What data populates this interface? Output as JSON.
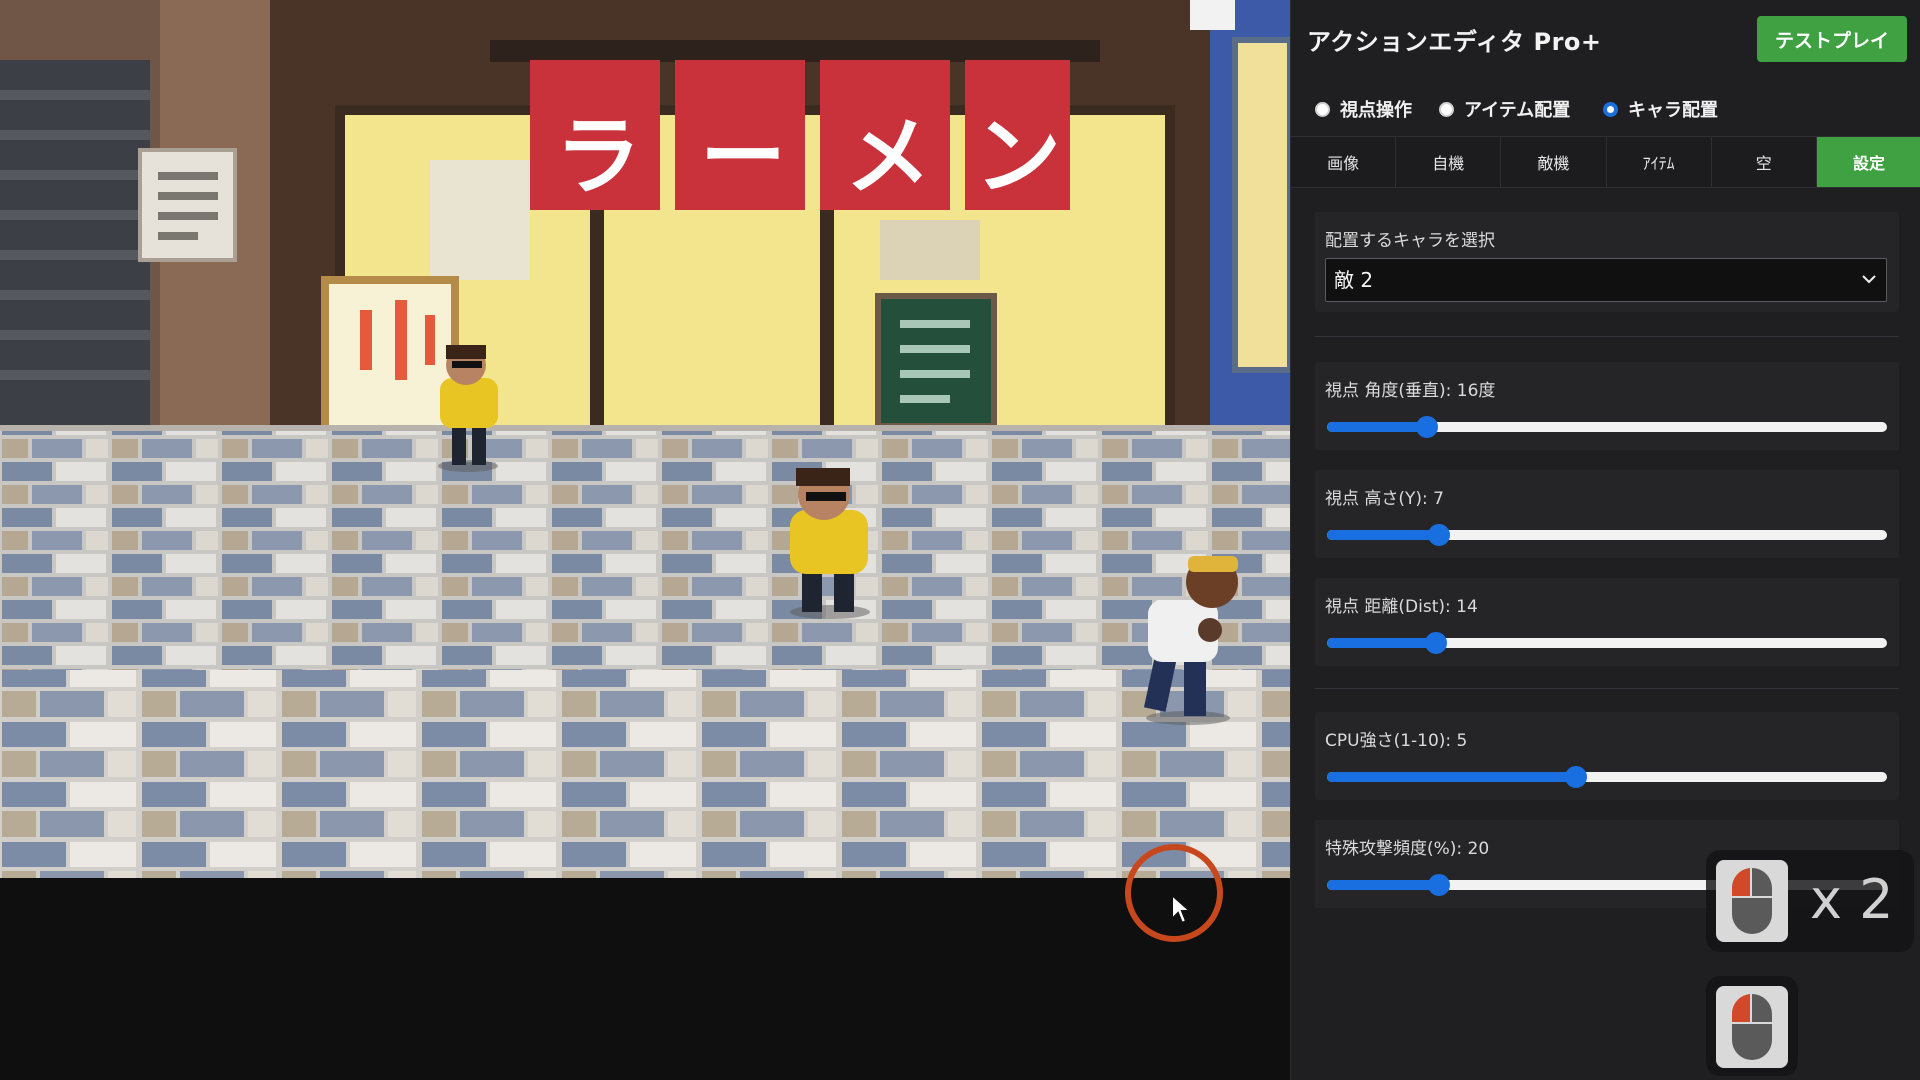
{
  "panel": {
    "title": "アクションエディタ Pro+",
    "testplay_label": "テストプレイ",
    "modes": [
      {
        "label": "視点操作",
        "checked": false
      },
      {
        "label": "アイテム配置",
        "checked": false
      },
      {
        "label": "キャラ配置",
        "checked": true
      }
    ],
    "tabs": [
      {
        "label": "画像",
        "active": false
      },
      {
        "label": "自機",
        "active": false
      },
      {
        "label": "敵機",
        "active": false
      },
      {
        "label": "ｱｲﾃﾑ",
        "active": false
      },
      {
        "label": "空",
        "active": false
      },
      {
        "label": "設定",
        "active": true
      }
    ],
    "chara_select": {
      "label": "配置するキャラを選択",
      "selected": "敵 2"
    },
    "camera_sliders": [
      {
        "label": "視点 角度(垂直): 16度",
        "value": 16,
        "min": 0,
        "max": 90
      },
      {
        "label": "視点 高さ(Y): 7",
        "value": 7,
        "min": 0,
        "max": 35
      },
      {
        "label": "視点 距離(Dist): 14",
        "value": 14,
        "min": 0,
        "max": 72
      }
    ],
    "ai_sliders": [
      {
        "label": "CPU強さ(1-10): 5",
        "value": 5,
        "min": 1,
        "max": 10
      },
      {
        "label": "特殊攻撃頻度(%): 20",
        "value": 20,
        "min": 0,
        "max": 100
      }
    ]
  },
  "scene": {
    "shop_sign": [
      "ラ",
      "ー",
      "メ",
      "ン"
    ]
  },
  "overlay": {
    "click_count": "x 2"
  },
  "colors": {
    "accent_green": "#3fa142",
    "slider_blue": "#1a6fe0",
    "click_ring": "#c8481d",
    "sign_red": "#c9313b"
  }
}
